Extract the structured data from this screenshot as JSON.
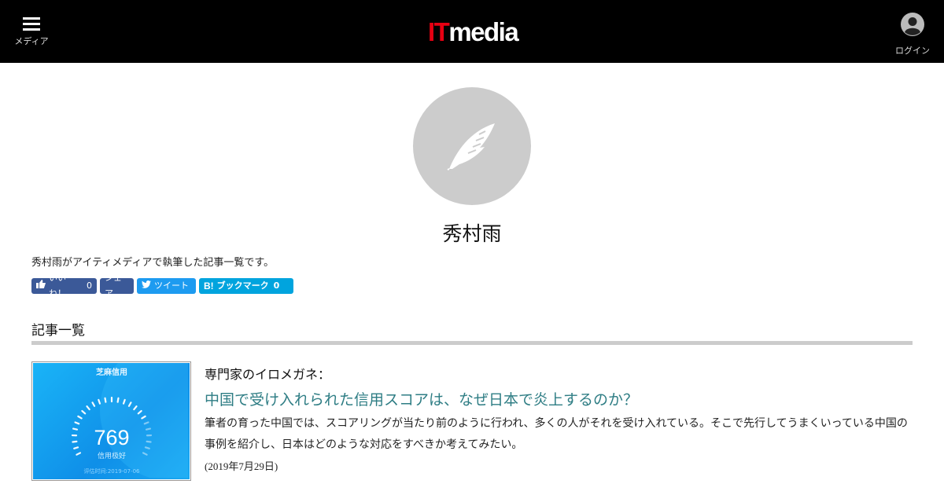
{
  "header": {
    "menu_label": "メディア",
    "logo_it": "IT",
    "logo_media": "media",
    "login_label": "ログイン"
  },
  "author": {
    "name": "秀村雨",
    "description": "秀村雨がアイティメディアで執筆した記事一覧です。"
  },
  "share": {
    "like_label": "いいね！",
    "like_count": "0",
    "share_label": "シェア",
    "tweet_label": "ツイート",
    "bookmark_label": "ブックマーク",
    "bookmark_count": "0"
  },
  "section": {
    "title": "記事一覧"
  },
  "articles": [
    {
      "kicker": "専門家のイロメガネ：",
      "title": "中国で受け入れられた信用スコアは、なぜ日本で炎上するのか？",
      "summary": "筆者の育った中国では、スコアリングが当たり前のように行われ、多くの人がそれを受け入れている。そこで先行してうまくいっている中国の事例を紹介し、日本はどのような対応をすべきか考えてみたい。",
      "date": "(2019年7月29日)",
      "thumbnail": {
        "app_name": "芝麻信用",
        "score": "769",
        "rating": "信用极好",
        "eval_time": "评估时间:2019-07-06"
      }
    }
  ],
  "colors": {
    "header_bg": "#000000",
    "logo_red": "#e60012",
    "headline_teal": "#2e7d84",
    "facebook": "#3b5998",
    "twitter": "#1d9bf0",
    "hatena": "#00a4de"
  }
}
